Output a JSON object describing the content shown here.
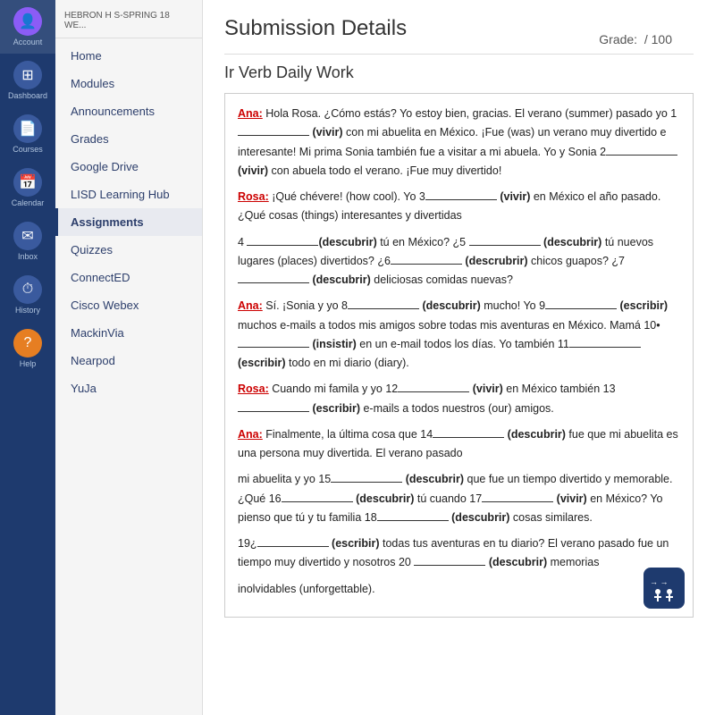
{
  "sidebar": {
    "icons": [
      {
        "id": "account",
        "label": "Account",
        "symbol": "👤"
      },
      {
        "id": "dashboard",
        "label": "Dashboard",
        "symbol": "⊞"
      },
      {
        "id": "courses",
        "label": "Courses",
        "symbol": "📄"
      },
      {
        "id": "calendar",
        "label": "Calendar",
        "symbol": "📅"
      },
      {
        "id": "inbox",
        "label": "Inbox",
        "symbol": "✉"
      },
      {
        "id": "history",
        "label": "History",
        "symbol": "⏱"
      },
      {
        "id": "help",
        "label": "Help",
        "symbol": "?"
      }
    ]
  },
  "nav": {
    "header": "HEBRON H S-SPRING 18 WE...",
    "items": [
      {
        "id": "home",
        "label": "Home",
        "active": false
      },
      {
        "id": "modules",
        "label": "Modules",
        "active": false
      },
      {
        "id": "announcements",
        "label": "Announcements",
        "active": false
      },
      {
        "id": "grades",
        "label": "Grades",
        "active": false
      },
      {
        "id": "google-drive",
        "label": "Google Drive",
        "active": false
      },
      {
        "id": "lisd-hub",
        "label": "LISD Learning Hub",
        "active": false
      },
      {
        "id": "assignments",
        "label": "Assignments",
        "active": true
      },
      {
        "id": "quizzes",
        "label": "Quizzes",
        "active": false
      },
      {
        "id": "connected",
        "label": "ConnectED",
        "active": false
      },
      {
        "id": "cisco",
        "label": "Cisco Webex",
        "active": false
      },
      {
        "id": "mackin",
        "label": "MackinVia",
        "active": false
      },
      {
        "id": "nearpod",
        "label": "Nearpod",
        "active": false
      },
      {
        "id": "yuja",
        "label": "YuJa",
        "active": false
      }
    ]
  },
  "main": {
    "title": "Submission Details",
    "grade_label": "Grade:",
    "grade_value": "/ 100",
    "subtitle": "Ir Verb Daily Work"
  }
}
